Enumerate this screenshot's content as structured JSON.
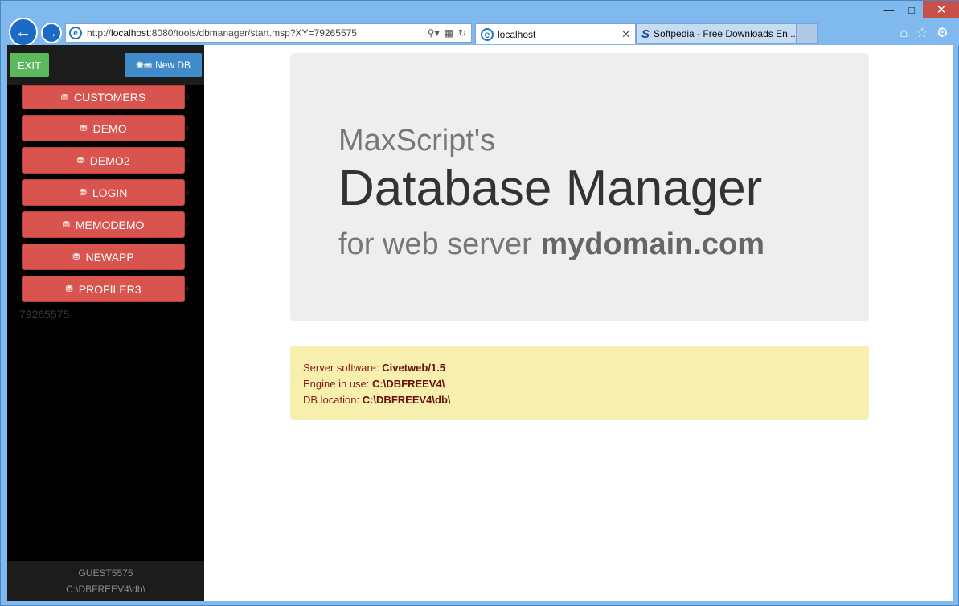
{
  "browser": {
    "url_prefix": "http://",
    "url_host": "localhost",
    "url_rest": ":8080/tools/dbmanager/start.msp?XY=79265575",
    "tabs": [
      {
        "title": "localhost"
      },
      {
        "title": "Softpedia - Free Downloads En..."
      }
    ]
  },
  "sidebar": {
    "exit_label": "EXIT",
    "new_db_label": "New DB",
    "databases": [
      {
        "name": "CUSTOMERS",
        "count": "0"
      },
      {
        "name": "DEMO",
        "count": "3"
      },
      {
        "name": "DEMO2",
        "count": "0"
      },
      {
        "name": "LOGIN",
        "count": "3"
      },
      {
        "name": "MEMODEMO",
        "count": "2"
      },
      {
        "name": "NEWAPP",
        "count": ""
      },
      {
        "name": "PROFILER3",
        "count": "4"
      }
    ],
    "session_id": "79265575",
    "footer_user": "GUEST5575",
    "footer_path": "C:\\DBFREEV4\\db\\"
  },
  "main": {
    "pre_title": "MaxScript's",
    "title": "Database Manager",
    "subtitle_prefix": "for web server",
    "subtitle_domain": "mydomain.com",
    "info": {
      "server_label": "Server software:",
      "server_value": "Civetweb/1.5",
      "engine_label": "Engine in use:",
      "engine_value": "C:\\DBFREEV4\\",
      "location_label": "DB location:",
      "location_value": "C:\\DBFREEV4\\db\\"
    }
  }
}
